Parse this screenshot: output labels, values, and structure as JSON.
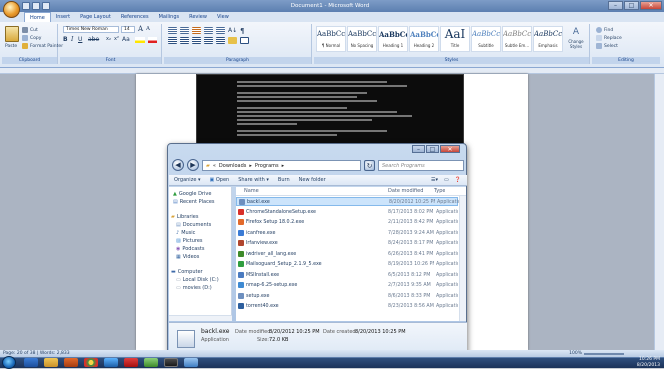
{
  "window": {
    "title": "Document1 - Microsoft Word",
    "controls": [
      "–",
      "□",
      "✕"
    ]
  },
  "ribbon": {
    "tabs": [
      "Home",
      "Insert",
      "Page Layout",
      "References",
      "Mailings",
      "Review",
      "View"
    ],
    "clipboard": {
      "paste": "Paste",
      "cut": "Cut",
      "copy": "Copy",
      "format_painter": "Format Painter",
      "label": "Clipboard"
    },
    "font": {
      "name": "Times New Roman",
      "size": "14",
      "label": "Font"
    },
    "paragraph": {
      "label": "Paragraph"
    },
    "styles": {
      "label": "Styles",
      "items": [
        {
          "sample": "AaBbCcDc",
          "name": "¶ Normal"
        },
        {
          "sample": "AaBbCcDc",
          "name": "No Spacing"
        },
        {
          "sample": "AaBbCc",
          "name": "Heading 1"
        },
        {
          "sample": "AaBbCcI",
          "name": "Heading 2"
        },
        {
          "sample": "AaI",
          "name": "Title"
        },
        {
          "sample": "AaBbCcDc",
          "name": "Subtitle"
        },
        {
          "sample": "AaBbCcDc",
          "name": "Subtle Em..."
        },
        {
          "sample": "AaBbCcDc",
          "name": "Emphasis"
        }
      ],
      "change_styles": "Change Styles"
    },
    "editing": {
      "find": "Find",
      "replace": "Replace",
      "select": "Select",
      "label": "Editing"
    }
  },
  "explorer": {
    "breadcrumb": [
      "Downloads",
      "Programs"
    ],
    "search_placeholder": "Search Programs",
    "commands": [
      "Organize ▾",
      "Open",
      "Share with ▾",
      "Burn",
      "New folder"
    ],
    "nav": {
      "favorites": [
        "Google Drive",
        "Recent Places"
      ],
      "libraries_header": "Libraries",
      "libraries": [
        "Documents",
        "Music",
        "Pictures",
        "Podcasts",
        "Videos"
      ],
      "computer_header": "Computer",
      "drives": [
        "Local Disk (C:)",
        "movies (D:)"
      ]
    },
    "columns": [
      "Name",
      "Date modified",
      "Type"
    ],
    "files": [
      {
        "name": "backl.exe",
        "date": "8/20/2012 10:25 PM",
        "type": "Applicatio",
        "selected": true
      },
      {
        "name": "ChromeStandaloneSetup.exe",
        "date": "8/17/2013 8:02 PM",
        "type": "Applicatio"
      },
      {
        "name": "Firefox Setup 18.0.2.exe",
        "date": "2/11/2013 8:42 PM",
        "type": "Applicatio"
      },
      {
        "name": "icanfree.exe",
        "date": "7/28/2013 9:24 AM",
        "type": "Applicatio"
      },
      {
        "name": "Irfanview.exe",
        "date": "8/24/2013 8:17 PM",
        "type": "Applicatio"
      },
      {
        "name": "iwdriver_all_lang.exe",
        "date": "6/26/2013 8:41 PM",
        "type": "Applicatio"
      },
      {
        "name": "Mailsoguard_Setup_2.1.9_5.exe",
        "date": "8/19/2013 10:26 PM",
        "type": "Applicatio"
      },
      {
        "name": "MSIInstall.exe",
        "date": "6/5/2013 8:12 PM",
        "type": "Applicatio"
      },
      {
        "name": "nmap-6.25-setup.exe",
        "date": "2/7/2013 9:35 AM",
        "type": "Applicatio"
      },
      {
        "name": "setup.exe",
        "date": "8/6/2013 8:33 PM",
        "type": "Applicatio"
      },
      {
        "name": "torrent40.exe",
        "date": "8/23/2013 8:56 AM",
        "type": "Applicatio"
      }
    ],
    "details": {
      "name": "backl.exe",
      "type": "Application",
      "date_modified_label": "Date modified:",
      "date_modified": "8/20/2012 10:25 PM",
      "date_created_label": "Date created:",
      "date_created": "8/20/2013 10:25 PM",
      "size_label": "Size:",
      "size": "72.0 KB"
    }
  },
  "status": {
    "page": "Page: 20 of 38",
    "words": "Words: 2,833",
    "zoom": "100%"
  },
  "tray": {
    "time": "10:26 PM",
    "date": "8/20/2013"
  }
}
